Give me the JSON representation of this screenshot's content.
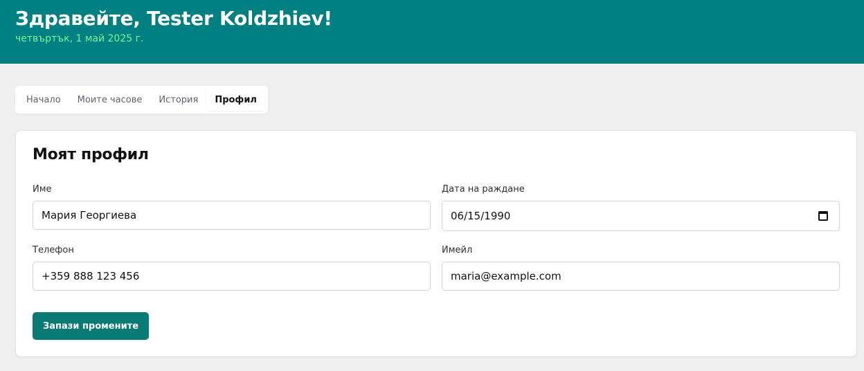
{
  "header": {
    "greeting": "Здравейте, Tester Koldzhiev!",
    "date": "четвъртък, 1 май 2025 г."
  },
  "tabs": [
    {
      "label": "Начало"
    },
    {
      "label": "Моите часове"
    },
    {
      "label": "История"
    },
    {
      "label": "Профил"
    }
  ],
  "active_tab": "Профил",
  "profile": {
    "title": "Моят профил",
    "name_label": "Име",
    "name_value": "Мария Георгиева",
    "birthdate_label": "Дата на раждане",
    "birthdate_value": "06/15/1990",
    "phone_label": "Телефон",
    "phone_value": "+359 888 123 456",
    "email_label": "Имейл",
    "email_value": "maria@example.com",
    "save_label": "Запази промените"
  },
  "colors": {
    "header_bg": "#008080",
    "date_text": "#7cf59a",
    "button_bg": "#0a7a75",
    "page_bg": "#efefef"
  },
  "icons": {
    "date_picker": "calendar-icon"
  }
}
